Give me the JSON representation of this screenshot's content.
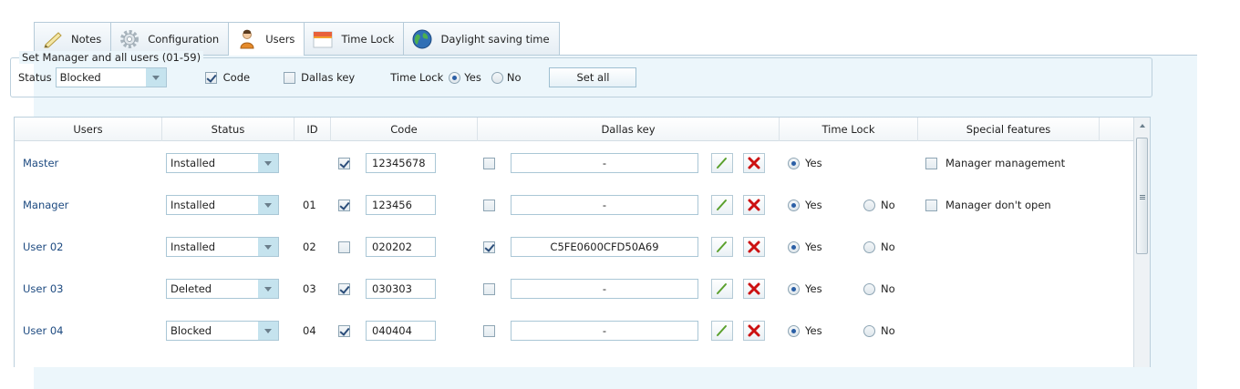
{
  "tabs": [
    {
      "label": "Notes",
      "icon": "pencil-icon",
      "active": false
    },
    {
      "label": "Configuration",
      "icon": "gear-icon",
      "active": false
    },
    {
      "label": "Users",
      "icon": "user-icon",
      "active": true
    },
    {
      "label": "Time Lock",
      "icon": "calendar-icon",
      "active": false
    },
    {
      "label": "Daylight saving time",
      "icon": "globe-icon",
      "active": false
    }
  ],
  "group": {
    "legend": "Set Manager and all users (01-59)",
    "status_label": "Status",
    "status_value": "Blocked",
    "code_label": "Code",
    "code_checked": true,
    "dallas_label": "Dallas key",
    "dallas_checked": false,
    "timelock_label": "Time Lock",
    "yes_label": "Yes",
    "no_label": "No",
    "timelock_value": "Yes",
    "set_all_label": "Set all"
  },
  "grid": {
    "columns": [
      "Users",
      "Status",
      "ID",
      "Code",
      "Dallas key",
      "Time Lock",
      "Special features"
    ],
    "yes_label": "Yes",
    "no_label": "No",
    "rows": [
      {
        "user": "Master",
        "status": "Installed",
        "id": "",
        "code_checked": true,
        "code": "12345678",
        "dallas_checked": false,
        "dallas": "-",
        "timelock": "Yes",
        "show_no": false,
        "feature_label": "Manager management",
        "feature_checked": false
      },
      {
        "user": "Manager",
        "status": "Installed",
        "id": "01",
        "code_checked": true,
        "code": "123456",
        "dallas_checked": false,
        "dallas": "-",
        "timelock": "Yes",
        "show_no": true,
        "feature_label": "Manager don't open",
        "feature_checked": false
      },
      {
        "user": "User 02",
        "status": "Installed",
        "id": "02",
        "code_checked": false,
        "code": "020202",
        "dallas_checked": true,
        "dallas": "C5FE0600CFD50A69",
        "timelock": "Yes",
        "show_no": true,
        "feature_label": "",
        "feature_checked": false
      },
      {
        "user": "User 03",
        "status": "Deleted",
        "id": "03",
        "code_checked": true,
        "code": "030303",
        "dallas_checked": false,
        "dallas": "-",
        "timelock": "Yes",
        "show_no": true,
        "feature_label": "",
        "feature_checked": false
      },
      {
        "user": "User 04",
        "status": "Blocked",
        "id": "04",
        "code_checked": true,
        "code": "040404",
        "dallas_checked": false,
        "dallas": "-",
        "timelock": "Yes",
        "show_no": true,
        "feature_label": "",
        "feature_checked": false
      }
    ]
  },
  "colors": {
    "accent": "#1d4a80",
    "panel_bg": "#ecf6fb",
    "delete_red": "#cc1111",
    "edit_green": "#5aa02c"
  }
}
